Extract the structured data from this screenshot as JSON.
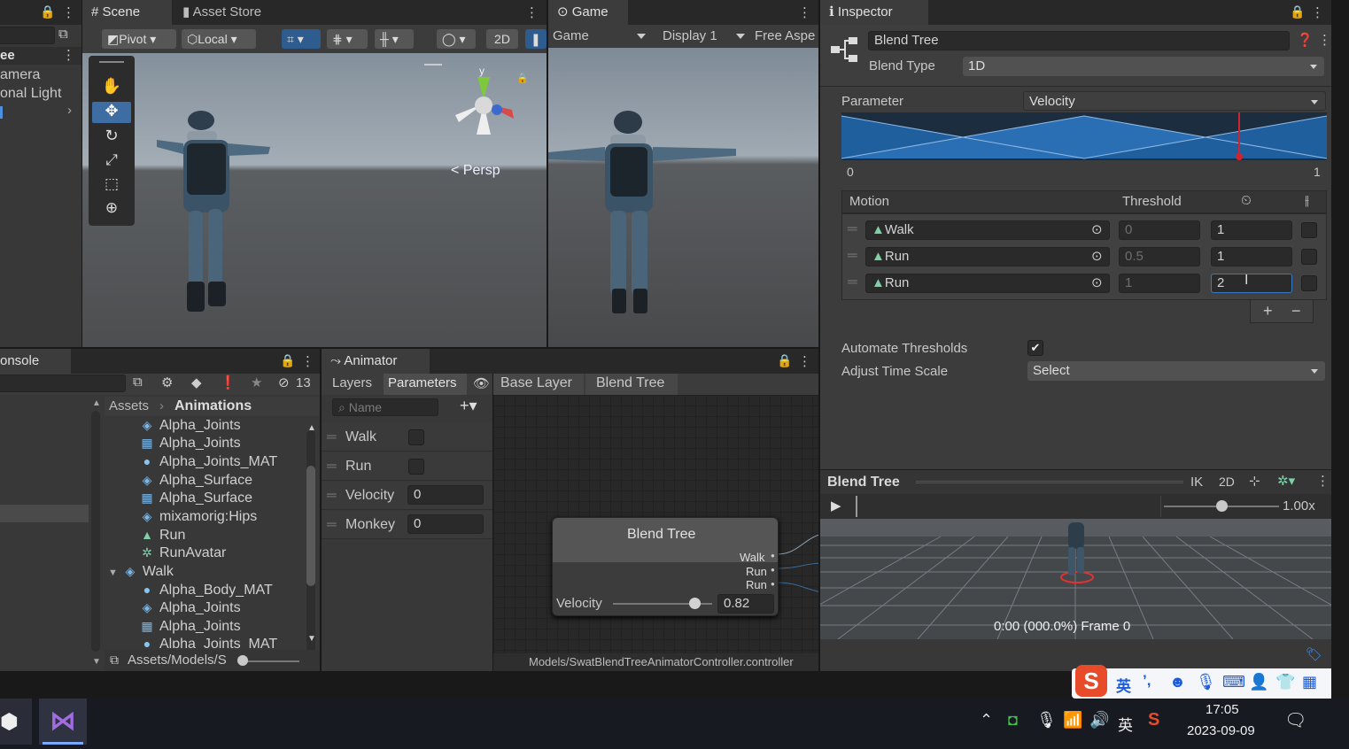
{
  "scene": {
    "tabs": [
      "Scene",
      "Asset Store"
    ],
    "pivot": "Pivot",
    "local": "Local",
    "btn_2d": "2D",
    "axis_y": "y",
    "persp": "< Persp"
  },
  "hierarchy": {
    "title": "ee",
    "items": [
      "amera",
      "onal Light"
    ]
  },
  "game": {
    "tab": "Game",
    "view": "Game",
    "display": "Display 1",
    "aspect": "Free Aspe"
  },
  "inspector": {
    "tab": "Inspector",
    "name": "Blend Tree",
    "blend_type_label": "Blend Type",
    "blend_type_value": "1D",
    "parameter_label": "Parameter",
    "parameter_value": "Velocity",
    "graph_min": "0",
    "graph_max": "1",
    "graph_marker": 0.82,
    "motion_header": "Motion",
    "threshold_header": "Threshold",
    "motions": [
      {
        "name": "Walk",
        "threshold": "0",
        "speed": "1"
      },
      {
        "name": "Run",
        "threshold": "0.5",
        "speed": "1"
      },
      {
        "name": "Run",
        "threshold": "1",
        "speed": "2"
      }
    ],
    "plus": "+",
    "minus": "−",
    "automate_label": "Automate Thresholds",
    "adjust_label": "Adjust Time Scale",
    "adjust_value": "Select"
  },
  "preview": {
    "title": "Blend Tree",
    "ik": "IK",
    "btn_2d": "2D",
    "speed": "1.00x",
    "speed_level": 0.45,
    "status": "0:00 (000.0%) Frame 0"
  },
  "console": {
    "tab": "onsole",
    "hidden_count": "13"
  },
  "project": {
    "breadcrumb_root": "Assets",
    "breadcrumb_leaf": "Animations",
    "items": [
      {
        "icon": "mesh-icon",
        "label": "Alpha_Joints"
      },
      {
        "icon": "grid-icon",
        "label": "Alpha_Joints"
      },
      {
        "icon": "material-icon",
        "label": "Alpha_Joints_MAT"
      },
      {
        "icon": "mesh-icon",
        "label": "Alpha_Surface"
      },
      {
        "icon": "grid-icon",
        "label": "Alpha_Surface"
      },
      {
        "icon": "mesh-icon",
        "label": "mixamorig:Hips"
      },
      {
        "icon": "clip-icon",
        "label": "Run"
      },
      {
        "icon": "avatar-icon",
        "label": "RunAvatar"
      },
      {
        "icon": "model-icon",
        "label": "Walk"
      },
      {
        "icon": "material-icon",
        "label": "Alpha_Body_MAT"
      },
      {
        "icon": "mesh-icon",
        "label": "Alpha_Joints"
      },
      {
        "icon": "grid-icon",
        "label": "Alpha_Joints"
      },
      {
        "icon": "material-icon",
        "label": "Alpha_Joints_MAT"
      }
    ],
    "path": "Assets/Models/S"
  },
  "animator": {
    "tab": "Animator",
    "layers_tab": "Layers",
    "params_tab": "Parameters",
    "crumb1": "Base Layer",
    "crumb2": "Blend Tree",
    "search_placeholder": "Name",
    "params": [
      {
        "name": "Walk",
        "type": "bool"
      },
      {
        "name": "Run",
        "type": "bool"
      },
      {
        "name": "Velocity",
        "value": "0"
      },
      {
        "name": "Monkey",
        "value": "0"
      }
    ],
    "node": {
      "title": "Blend Tree",
      "outputs": [
        "Walk",
        "Run",
        "Run"
      ],
      "param": "Velocity",
      "value": "0.82"
    },
    "footer": "Models/SwatBlendTreeAnimatorController.controller"
  },
  "ime": {
    "lang": "英",
    "punct": "’,"
  },
  "taskbar": {
    "time": "17:05",
    "date": "2023-09-09",
    "lang": "英"
  },
  "colors": {
    "accent": "#3a72b0",
    "graph_fill": "#1f5f9e",
    "marker": "#d0242c"
  }
}
